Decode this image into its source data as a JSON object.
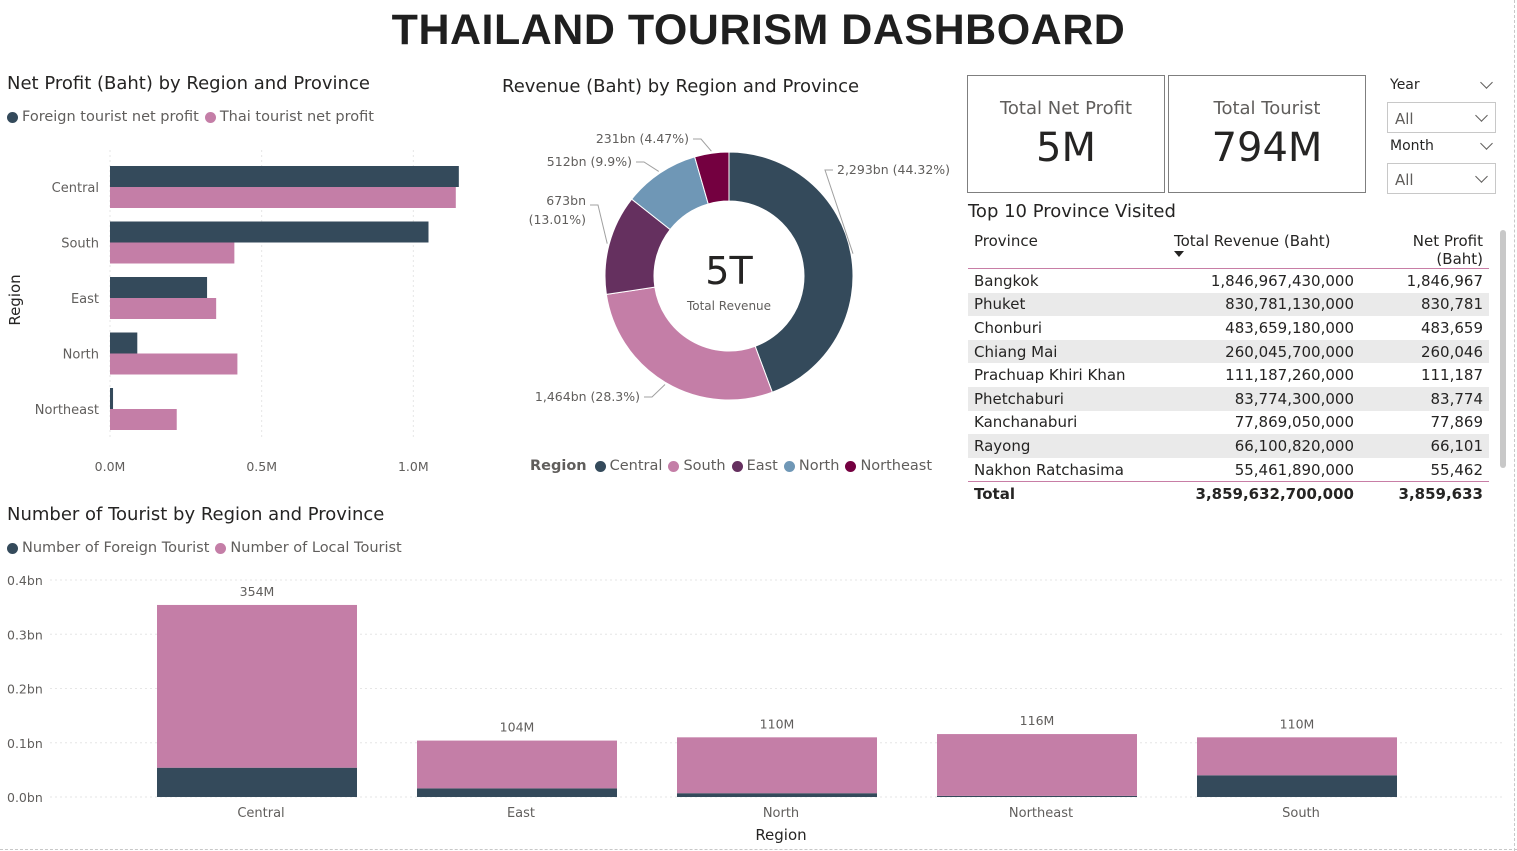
{
  "dashboard": {
    "title": "THAILAND TOURISM DASHBOARD"
  },
  "colors": {
    "dark": "#344A5B",
    "pink": "#C47EA7",
    "purple": "#65305F",
    "blue": "#6F97B6",
    "maroon": "#740040"
  },
  "cards": {
    "net_profit": {
      "label": "Total Net Profit",
      "value": "5M"
    },
    "tourist": {
      "label": "Total Tourist",
      "value": "794M"
    }
  },
  "slicers": {
    "year": {
      "label": "Year",
      "value": "All"
    },
    "month": {
      "label": "Month",
      "value": "All"
    }
  },
  "table": {
    "title": "Top 10 Province Visited",
    "columns": [
      "Province",
      "Total Revenue (Baht)",
      "Net Profit (Baht)"
    ],
    "rows": [
      [
        "Bangkok",
        "1,846,967,430,000",
        "1,846,967"
      ],
      [
        "Phuket",
        "830,781,130,000",
        "830,781"
      ],
      [
        "Chonburi",
        "483,659,180,000",
        "483,659"
      ],
      [
        "Chiang Mai",
        "260,045,700,000",
        "260,046"
      ],
      [
        "Prachuap Khiri Khan",
        "111,187,260,000",
        "111,187"
      ],
      [
        "Phetchaburi",
        "83,774,300,000",
        "83,774"
      ],
      [
        "Kanchanaburi",
        "77,869,050,000",
        "77,869"
      ],
      [
        "Rayong",
        "66,100,820,000",
        "66,101"
      ],
      [
        "Nakhon Ratchasima",
        "55,461,890,000",
        "55,462"
      ]
    ],
    "total": [
      "Total",
      "3,859,632,700,000",
      "3,859,633"
    ]
  },
  "chart_data": [
    {
      "type": "bar",
      "orientation": "horizontal",
      "title": "Net Profit (Baht) by Region and Province",
      "categories": [
        "Central",
        "South",
        "East",
        "North",
        "Northeast"
      ],
      "series": [
        {
          "name": "Foreign tourist net profit",
          "values": [
            1.15,
            1.05,
            0.32,
            0.09,
            0.01
          ]
        },
        {
          "name": "Thai tourist net profit",
          "values": [
            1.14,
            0.41,
            0.35,
            0.42,
            0.22
          ]
        }
      ],
      "xlabel": "",
      "ylabel": "Region",
      "xticks": [
        "0.0M",
        "0.5M",
        "1.0M"
      ],
      "xlim": [
        0,
        1.2
      ],
      "unit": "M",
      "grid": true,
      "legend": "top-left"
    },
    {
      "type": "pie",
      "donut": true,
      "title": "Revenue (Baht) by Region and Province",
      "center_value": "5T",
      "center_label": "Total Revenue",
      "legend_title": "Region",
      "slices": [
        {
          "name": "Central",
          "value": 2293,
          "label": "2,293bn (44.32%)"
        },
        {
          "name": "South",
          "value": 1464,
          "label": "1,464bn (28.3%)"
        },
        {
          "name": "East",
          "value": 673,
          "label_line1": "673bn",
          "label_line2": "(13.01%)"
        },
        {
          "name": "North",
          "value": 512,
          "label": "512bn (9.9%)"
        },
        {
          "name": "Northeast",
          "value": 231,
          "label": "231bn (4.47%)"
        }
      ],
      "legend": "bottom"
    },
    {
      "type": "bar",
      "stacked": true,
      "title": "Number of Tourist by Region and Province",
      "categories": [
        "Central",
        "East",
        "North",
        "Northeast",
        "South"
      ],
      "series": [
        {
          "name": "Number of Foreign Tourist",
          "values": [
            0.054,
            0.016,
            0.007,
            0.002,
            0.04
          ]
        },
        {
          "name": "Number of Local Tourist",
          "values": [
            0.3,
            0.088,
            0.103,
            0.114,
            0.07
          ]
        }
      ],
      "totals": [
        "354M",
        "104M",
        "110M",
        "116M",
        "110M"
      ],
      "xlabel": "Region",
      "ylabel": "",
      "yticks": [
        "0.0bn",
        "0.1bn",
        "0.2bn",
        "0.3bn",
        "0.4bn"
      ],
      "ylim": [
        0,
        0.4
      ],
      "grid": true,
      "legend": "top-left"
    }
  ]
}
